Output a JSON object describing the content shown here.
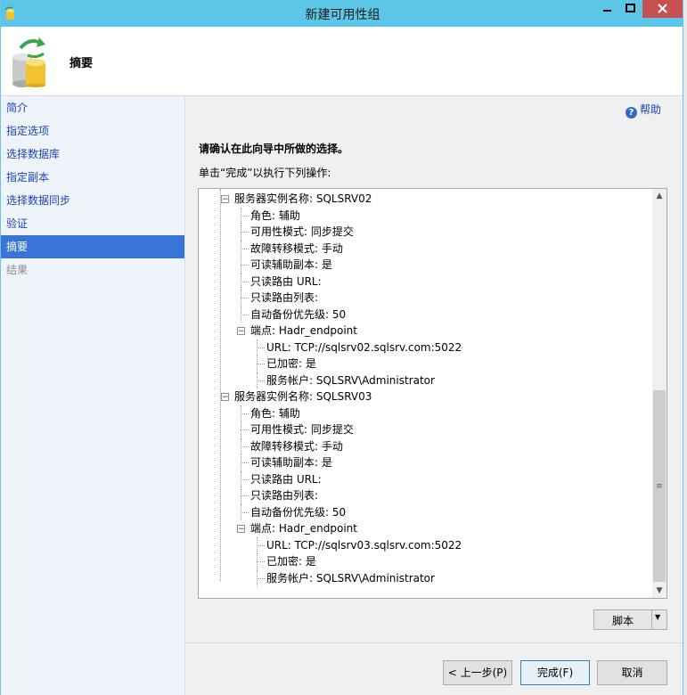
{
  "window": {
    "title": "新建可用性组"
  },
  "header": {
    "title": "摘要"
  },
  "sidebar": {
    "items": [
      {
        "label": "简介",
        "state": "normal"
      },
      {
        "label": "指定选项",
        "state": "normal"
      },
      {
        "label": "选择数据库",
        "state": "normal"
      },
      {
        "label": "指定副本",
        "state": "normal"
      },
      {
        "label": "选择数据同步",
        "state": "normal"
      },
      {
        "label": "验证",
        "state": "normal"
      },
      {
        "label": "摘要",
        "state": "active"
      },
      {
        "label": "结果",
        "state": "disabled"
      }
    ]
  },
  "help": {
    "label": "帮助"
  },
  "main": {
    "heading": "请确认在此向导中所做的选择。",
    "subheading": "单击“完成”以执行下列操作:",
    "tree": [
      {
        "level": 0,
        "expander": "⊟",
        "text": "服务器实例名称: SQLSRV02"
      },
      {
        "level": 1,
        "text": "角色: 辅助"
      },
      {
        "level": 1,
        "text": "可用性模式: 同步提交"
      },
      {
        "level": 1,
        "text": "故障转移模式: 手动"
      },
      {
        "level": 1,
        "text": "可读辅助副本: 是"
      },
      {
        "level": 1,
        "text": "只读路由 URL:"
      },
      {
        "level": 1,
        "text": "只读路由列表:"
      },
      {
        "level": 1,
        "text": "自动备份优先级: 50"
      },
      {
        "level": 1,
        "expander": "⊟",
        "text": "端点: Hadr_endpoint"
      },
      {
        "level": 2,
        "text": "URL: TCP://sqlsrv02.sqlsrv.com:5022"
      },
      {
        "level": 2,
        "text": "已加密: 是"
      },
      {
        "level": 2,
        "text": "服务帐户: SQLSRV\\Administrator"
      },
      {
        "level": 0,
        "expander": "⊟",
        "text": "服务器实例名称: SQLSRV03"
      },
      {
        "level": 1,
        "text": "角色: 辅助"
      },
      {
        "level": 1,
        "text": "可用性模式: 同步提交"
      },
      {
        "level": 1,
        "text": "故障转移模式: 手动"
      },
      {
        "level": 1,
        "text": "可读辅助副本: 是"
      },
      {
        "level": 1,
        "text": "只读路由 URL:"
      },
      {
        "level": 1,
        "text": "只读路由列表:"
      },
      {
        "level": 1,
        "text": "自动备份优先级: 50"
      },
      {
        "level": 1,
        "expander": "⊟",
        "text": "端点: Hadr_endpoint"
      },
      {
        "level": 2,
        "text": "URL: TCP://sqlsrv03.sqlsrv.com:5022"
      },
      {
        "level": 2,
        "text": "已加密: 是"
      },
      {
        "level": 2,
        "text": "服务帐户: SQLSRV\\Administrator"
      }
    ]
  },
  "buttons": {
    "script": "脚本",
    "back": "< 上一步(P)",
    "finish": "完成(F)",
    "cancel": "取消"
  },
  "colors": {
    "titlebar": "#5bc6e8",
    "close_button": "#c75050",
    "sidebar_link": "#1a44b8",
    "sidebar_active": "#3875d6"
  },
  "icons": {
    "app": "sql-app-icon",
    "wizard": "database-sync-icon",
    "help": "help-icon"
  }
}
